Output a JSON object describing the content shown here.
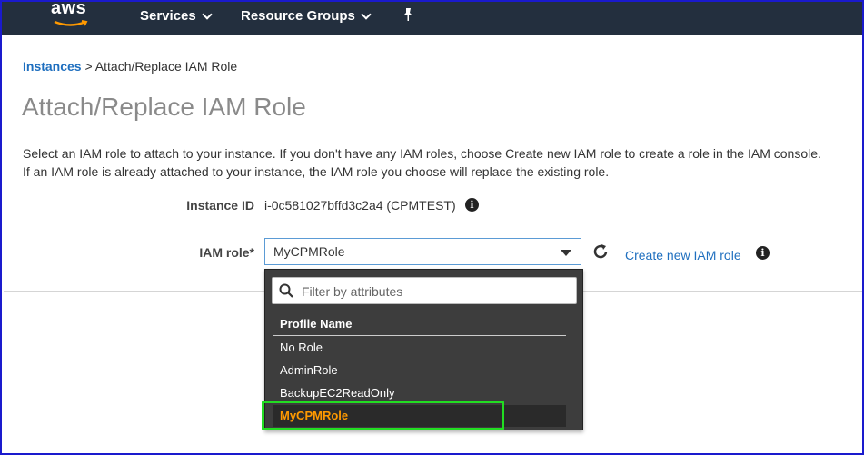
{
  "topbar": {
    "logo_text": "aws",
    "services_label": "Services",
    "resource_groups_label": "Resource Groups",
    "pin_icon": "pin-icon"
  },
  "breadcrumb": {
    "link": "Instances",
    "separator": ">",
    "current": "Attach/Replace IAM Role"
  },
  "page": {
    "title": "Attach/Replace IAM Role",
    "description_line1": "Select an IAM role to attach to your instance. If you don't have any IAM roles, choose Create new IAM role to create a role in the IAM console.",
    "description_line2": "If an IAM role is already attached to your instance, the IAM role you choose will replace the existing role."
  },
  "form": {
    "instance_id_label": "Instance ID",
    "instance_id_value": "i-0c581027bffd3c2a4 (CPMTEST)",
    "iam_role_label": "IAM role*",
    "iam_role_value": "MyCPMRole",
    "create_link": "Create new IAM role",
    "info_glyph": "i"
  },
  "dropdown": {
    "filter_placeholder": "Filter by attributes",
    "header": "Profile Name",
    "items": [
      "No Role",
      "AdminRole",
      "BackupEC2ReadOnly",
      "MyCPMRole"
    ],
    "selected": "MyCPMRole"
  },
  "colors": {
    "topbar": "#232f3e",
    "link": "#1f6fbf",
    "selected_item": "#ff9900",
    "highlight": "#22dd22",
    "window_border": "#1a1acd"
  }
}
